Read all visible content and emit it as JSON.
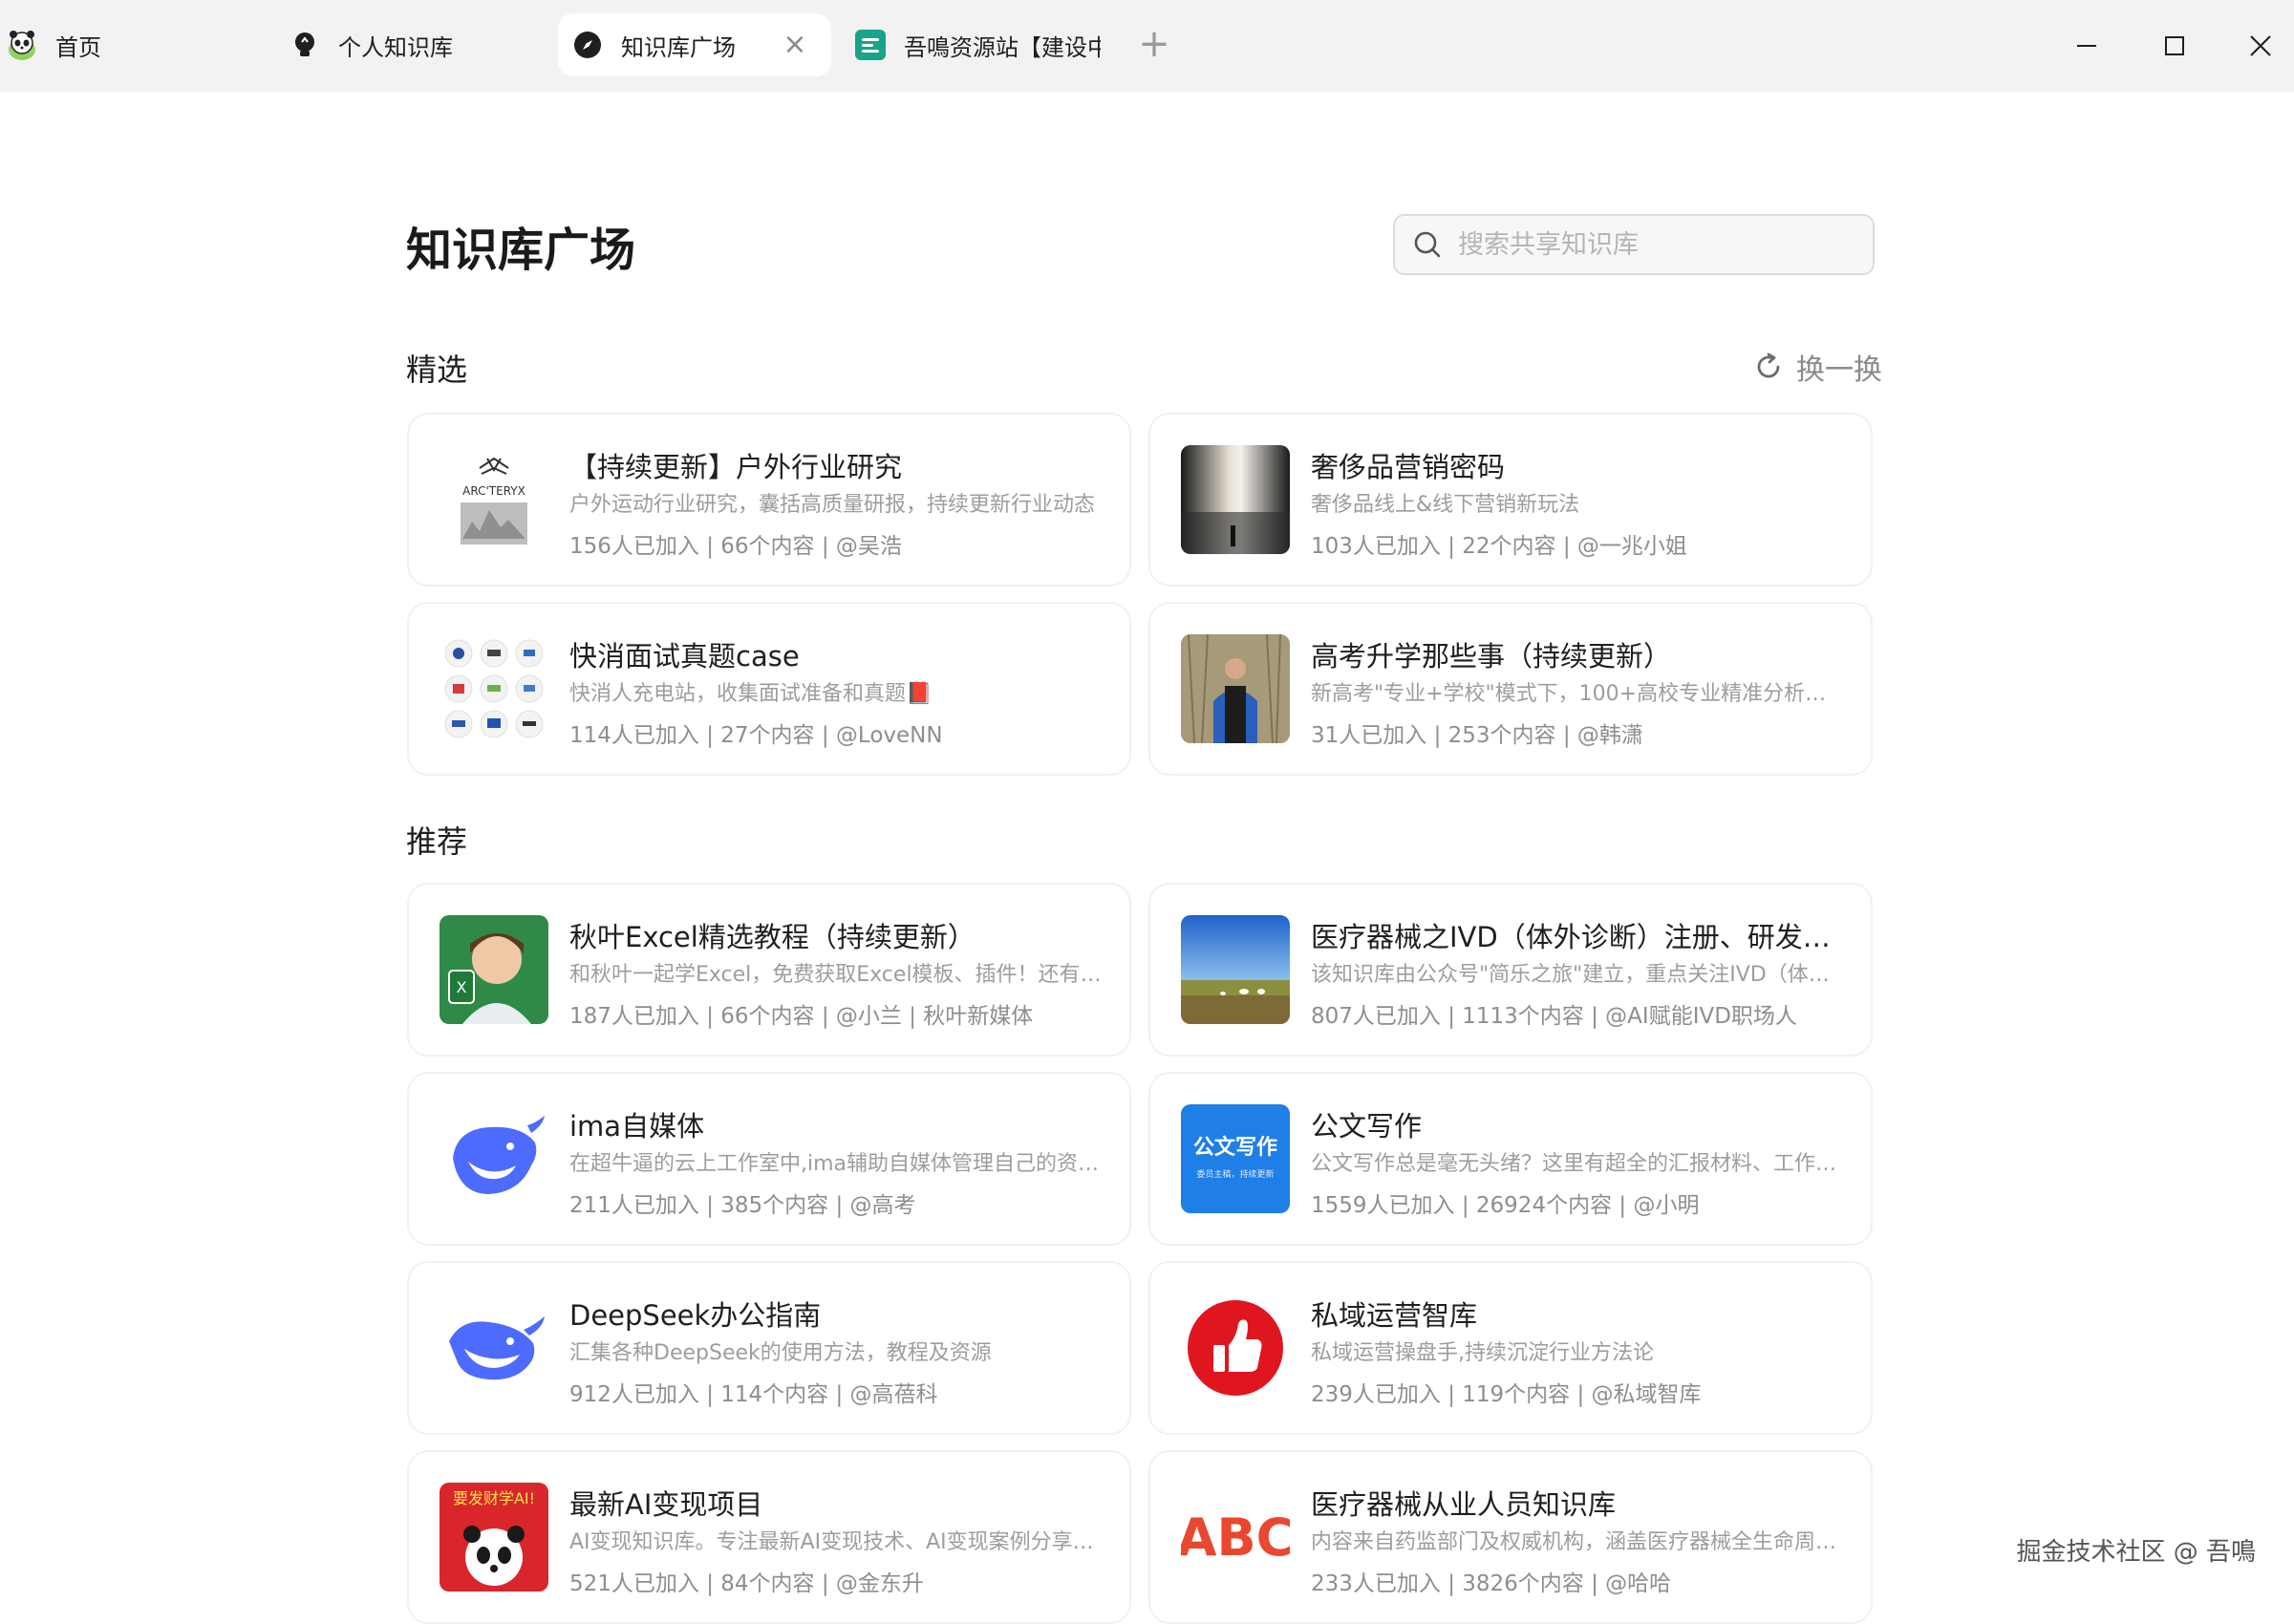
{
  "tabs": [
    {
      "label": "首页",
      "icon": "panda-icon",
      "active": false
    },
    {
      "label": "个人知识库",
      "icon": "bulb-icon",
      "active": false
    },
    {
      "label": "知识库广场",
      "icon": "compass-icon",
      "active": true
    },
    {
      "label": "吾鳴资源站【建设中",
      "icon": "app-icon",
      "active": false
    }
  ],
  "tab_close_glyph": "×",
  "new_tab_glyph": "+",
  "page": {
    "title": "知识库广场",
    "search_placeholder": "搜索共享知识库"
  },
  "sections": {
    "featured": "精选",
    "recommended": "推荐",
    "refresh_label": "换一换"
  },
  "featured_cards": [
    {
      "title": "【持续更新】户外行业研究",
      "desc": "户外运动行业研究，囊括高质量研报，持续更新行业动态",
      "meta": "156人已加入 | 66个内容 | @吴浩",
      "thumb_text": "ARC'TERYX"
    },
    {
      "title": "奢侈品营销密码",
      "desc": "奢侈品线上&线下营销新玩法",
      "meta": "103人已加入 | 22个内容 | @一兆小姐"
    },
    {
      "title": "快消面试真题case",
      "desc": "快消人充电站，收集面试准备和真题📕",
      "meta": "114人已加入 | 27个内容 | @LoveNN"
    },
    {
      "title": "高考升学那些事（持续更新）",
      "desc": "新高考\"专业+学校\"模式下，100+高校专业精准分析！找到…",
      "meta": "31人已加入 | 253个内容 | @韩潇"
    }
  ],
  "recommended_cards": [
    {
      "title": "秋叶Excel精选教程（持续更新）",
      "desc": "和秋叶一起学Excel，免费获取Excel模板、插件！还有Excel技巧…",
      "meta": "187人已加入 | 66个内容 | @小兰 | 秋叶新媒体"
    },
    {
      "title": "医疗器械之IVD（体外诊断）注册、研发、生产…",
      "desc": "该知识库由公众号\"简乐之旅\"建立，重点关注IVD（体外诊断）…",
      "meta": "807人已加入 | 1113个内容 | @AI赋能IVD职场人"
    },
    {
      "title": "ima自媒体",
      "desc": "在超牛逼的云上工作室中,ima辅助自媒体管理自己的资源库…",
      "meta": "211人已加入 | 385个内容 | @高考"
    },
    {
      "title": "公文写作",
      "desc": "公文写作总是毫无头绪？这里有超全的汇报材料、工作总结…",
      "meta": "1559人已加入 | 26924个内容 | @小明",
      "thumb_text": "公文写作",
      "thumb_sub": "委员主稿，持续更新"
    },
    {
      "title": "DeepSeek办公指南",
      "desc": "汇集各种DeepSeek的使用方法，教程及资源",
      "meta": "912人已加入 | 114个内容 | @高蓓科"
    },
    {
      "title": "私域运营智库",
      "desc": "私域运营操盘手,持续沉淀行业方法论",
      "meta": "239人已加入 | 119个内容 | @私域智库"
    },
    {
      "title": "最新AI变现项目",
      "desc": "AI变现知识库。专注最新AI变现技术、AI变现案例分享、AI…",
      "meta": "521人已加入 | 84个内容 | @金东升",
      "thumb_text": "要发财学AI!"
    },
    {
      "title": "医疗器械从业人员知识库",
      "desc": "内容来自药监部门及权威机构，涵盖医疗器械全生命周期…",
      "meta": "233人已加入 | 3826个内容 | @哈哈",
      "thumb_text": "ABC"
    }
  ],
  "watermark": "掘金技术社区 @ 吾鳴",
  "colors": {
    "accent_blue": "#3b5ce6",
    "red": "#e0161f",
    "tabbar": "#f2f2f3"
  }
}
